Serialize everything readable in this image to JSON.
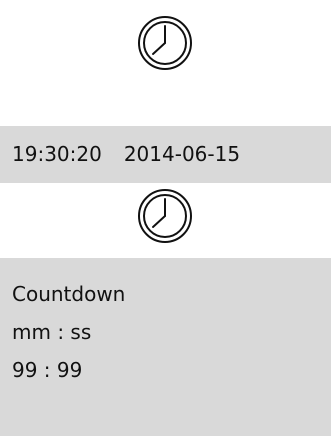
{
  "icons": {
    "top": "clock-icon",
    "bottom": "clock-icon"
  },
  "datetime": {
    "time": "19:30:20",
    "date": "2014-06-15"
  },
  "countdown": {
    "title": "Countdown",
    "format": "mm : ss",
    "value": "99 : 99"
  },
  "colors": {
    "panel_background": "#d9d9d9",
    "icon_stroke": "#111111",
    "text": "#111111"
  }
}
